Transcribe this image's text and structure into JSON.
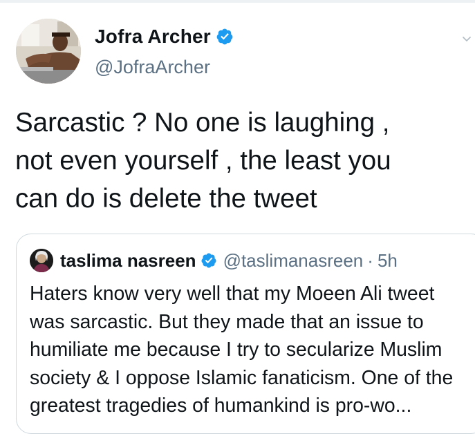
{
  "tweet": {
    "author": {
      "display_name": "Jofra Archer",
      "handle": "@JofraArcher",
      "verified": true
    },
    "text": "Sarcastic ? No one is laughing ,\nnot even yourself , the least you\ncan do is delete the tweet",
    "quoted_tweet": {
      "author": {
        "display_name": "taslima nasreen",
        "handle": "@taslimanasreen",
        "verified": true
      },
      "separator": "·",
      "time": "5h",
      "text": "Haters know very well that my Moeen Ali tweet was sarcastic. But they made that an issue to humiliate me because I try to secularize Muslim society & I oppose Islamic fanaticism. One of the greatest tragedies of humankind is pro-wo..."
    }
  },
  "icons": {
    "verified": "verified-badge-icon",
    "menu": "chevron-down-icon"
  },
  "colors": {
    "text": "#0f1419",
    "secondary": "#5b7083",
    "verified": "#1d9bf0",
    "border": "#cfd9de"
  }
}
